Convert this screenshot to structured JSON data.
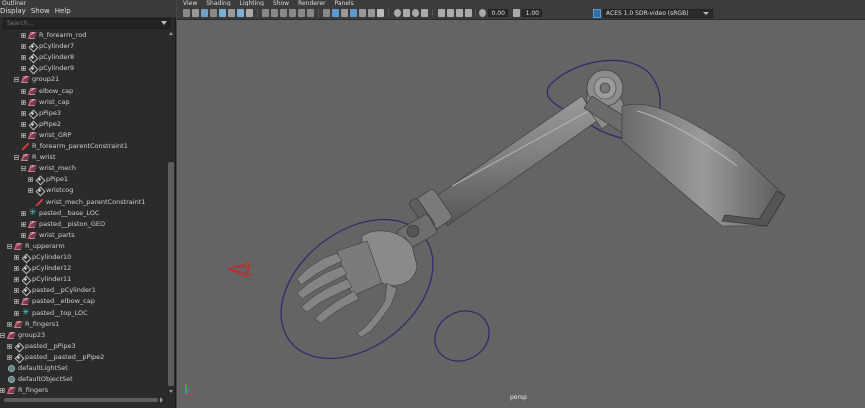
{
  "outliner": {
    "title": "Outliner",
    "menu": [
      "Display",
      "Show",
      "Help"
    ],
    "search_placeholder": "Search...",
    "items": [
      {
        "label": "R_forearm_rod",
        "icon": "group-icon",
        "depth": 2,
        "expander": "plus"
      },
      {
        "label": "pCylinder7",
        "icon": "mesh-icon",
        "depth": 2,
        "expander": "plus"
      },
      {
        "label": "pCylinder8",
        "icon": "mesh-icon",
        "depth": 2,
        "expander": "plus"
      },
      {
        "label": "pCylinder9",
        "icon": "mesh-icon",
        "depth": 2,
        "expander": "plus"
      },
      {
        "label": "group21",
        "icon": "group-icon",
        "depth": 1,
        "expander": "minus"
      },
      {
        "label": "elbow_cap",
        "icon": "group-icon",
        "depth": 2,
        "expander": "plus"
      },
      {
        "label": "wrist_cap",
        "icon": "group-icon",
        "depth": 2,
        "expander": "plus"
      },
      {
        "label": "pPipe3",
        "icon": "mesh-icon",
        "depth": 2,
        "expander": "plus"
      },
      {
        "label": "pPipe2",
        "icon": "mesh-icon",
        "depth": 2,
        "expander": "plus"
      },
      {
        "label": "wrist_GRP",
        "icon": "group-icon",
        "depth": 2,
        "expander": "plus"
      },
      {
        "label": "R_forearm_parentConstraint1",
        "icon": "constraint-icon",
        "depth": 1,
        "expander": "none"
      },
      {
        "label": "R_wrist",
        "icon": "group-icon",
        "depth": 1,
        "expander": "minus"
      },
      {
        "label": "wrist_mech",
        "icon": "group-icon",
        "depth": 2,
        "expander": "minus"
      },
      {
        "label": "pPipe1",
        "icon": "mesh-icon",
        "depth": 3,
        "expander": "plus"
      },
      {
        "label": "wristcog",
        "icon": "mesh-icon",
        "depth": 3,
        "expander": "plus"
      },
      {
        "label": "wrist_mech_parentConstraint1",
        "icon": "constraint-icon",
        "depth": 3,
        "expander": "none"
      },
      {
        "label": "pasted__base_LOC",
        "icon": "locator-icon",
        "depth": 2,
        "expander": "plus"
      },
      {
        "label": "pasted__piston_GEO",
        "icon": "group-icon",
        "depth": 2,
        "expander": "plus"
      },
      {
        "label": "wrist_parts",
        "icon": "group-icon",
        "depth": 2,
        "expander": "plus"
      },
      {
        "label": "R_upperarm",
        "icon": "group-icon",
        "depth": 0,
        "expander": "minus"
      },
      {
        "label": "pCylinder10",
        "icon": "mesh-icon",
        "depth": 1,
        "expander": "plus"
      },
      {
        "label": "pCylinder12",
        "icon": "mesh-icon",
        "depth": 1,
        "expander": "plus"
      },
      {
        "label": "pCylinder11",
        "icon": "mesh-icon",
        "depth": 1,
        "expander": "plus"
      },
      {
        "label": "pasted__pCylinder1",
        "icon": "mesh-icon",
        "depth": 1,
        "expander": "plus"
      },
      {
        "label": "pasted__elbow_cap",
        "icon": "group-icon",
        "depth": 1,
        "expander": "plus"
      },
      {
        "label": "pasted__top_LOC",
        "icon": "locator-icon",
        "depth": 1,
        "expander": "plus"
      },
      {
        "label": "R_fingers1",
        "icon": "group-icon",
        "depth": 0,
        "expander": "plus"
      },
      {
        "label": "group23",
        "icon": "group-icon",
        "depth": -1,
        "expander": "minus"
      },
      {
        "label": "pasted__pPipe3",
        "icon": "mesh-icon",
        "depth": 0,
        "expander": "plus"
      },
      {
        "label": "pasted__pasted__pPipe2",
        "icon": "mesh-icon",
        "depth": 0,
        "expander": "plus"
      },
      {
        "label": "defaultLightSet",
        "icon": "set-icon",
        "depth": -1,
        "expander": "none"
      },
      {
        "label": "defaultObjectSet",
        "icon": "set-icon",
        "depth": -1,
        "expander": "none"
      },
      {
        "label": "R_fingers",
        "icon": "group-icon",
        "depth": -1,
        "expander": "plus"
      }
    ]
  },
  "viewport": {
    "menu": [
      "View",
      "Shading",
      "Lighting",
      "Show",
      "Renderer",
      "Panels"
    ],
    "exposure": "0.00",
    "gamma": "1.00",
    "color_space": "ACES 1.0 SDR-video (sRGB)",
    "camera": "persp"
  }
}
